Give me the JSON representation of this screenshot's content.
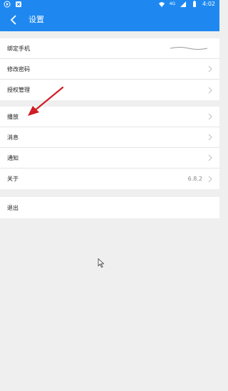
{
  "status_bar": {
    "time": "4:02",
    "network": "4G",
    "icons": [
      "play-badge-icon",
      "notification-badge-icon",
      "wifi-icon",
      "signal-icon",
      "battery-icon"
    ]
  },
  "app_bar": {
    "title": "设置",
    "back_icon": "chevron-left-icon",
    "color": "#1e88f0"
  },
  "groups": [
    {
      "items": [
        {
          "label": "绑定手机",
          "value": "",
          "masked_value": true,
          "chevron": false
        },
        {
          "label": "修改密码",
          "value": "",
          "chevron": true
        },
        {
          "label": "授权管理",
          "value": "",
          "chevron": true
        }
      ]
    },
    {
      "items": [
        {
          "label": "播放",
          "value": "",
          "chevron": true
        },
        {
          "label": "消息",
          "value": "",
          "chevron": true
        },
        {
          "label": "通知",
          "value": "",
          "chevron": true
        },
        {
          "label": "关于",
          "value": "6.8.2",
          "chevron": true
        }
      ]
    },
    {
      "items": [
        {
          "label": "退出",
          "value": "",
          "chevron": false
        }
      ]
    }
  ],
  "annotation": {
    "icon": "red-arrow-icon",
    "color": "#d01c24"
  },
  "cursor": {
    "icon": "mouse-pointer-icon"
  }
}
